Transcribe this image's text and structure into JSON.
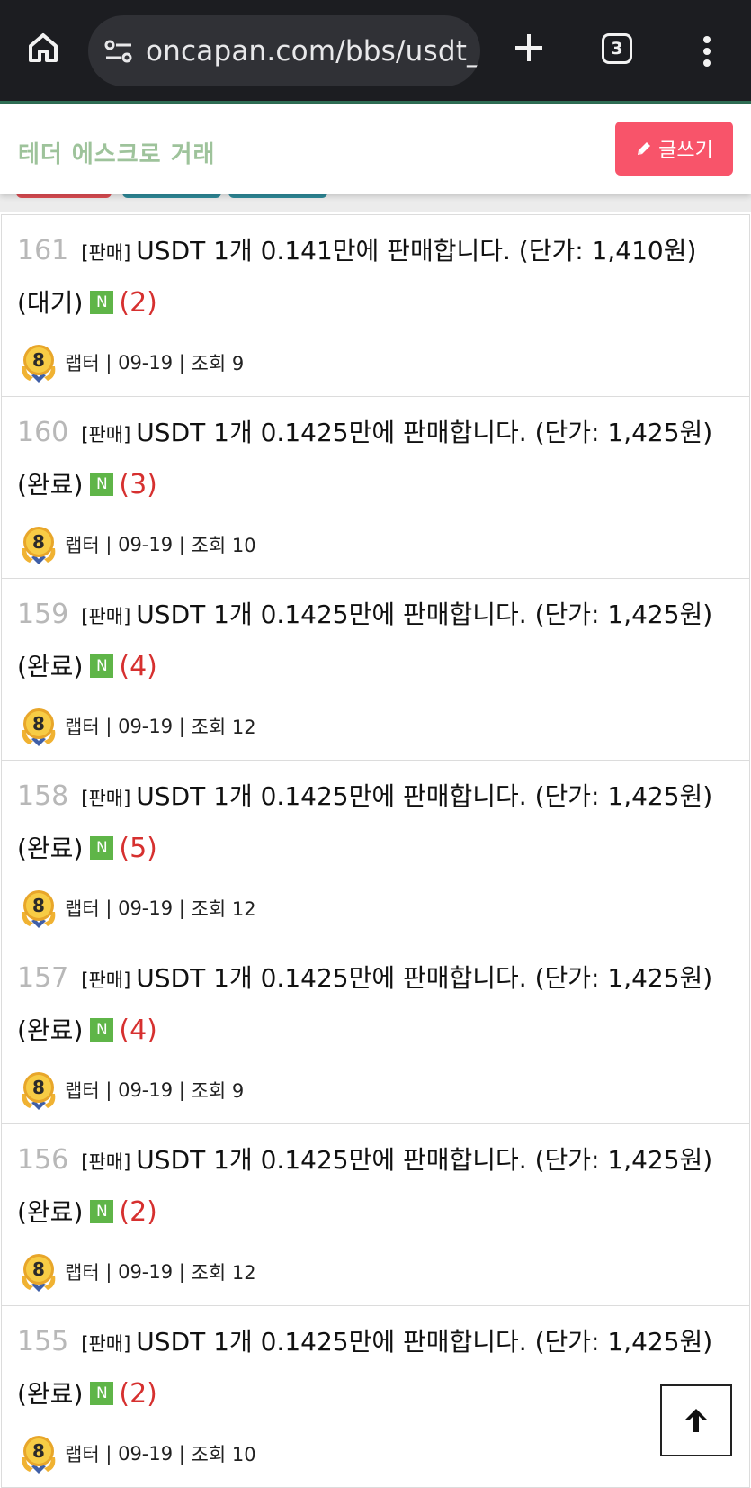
{
  "browser": {
    "url": "oncapan.com/bbs/usdt_",
    "tab_count": "3",
    "colors": {
      "toolbar": "#1c1d21",
      "url_bar": "#303136"
    }
  },
  "header": {
    "title": "테더 에스크로 거래",
    "write_label": "글쓰기",
    "colors": {
      "title": "#9ec39b",
      "write_button": "#f8546a"
    }
  },
  "category_tabs": [
    {
      "color": "#dd4d52"
    },
    {
      "color": "#2e8a99"
    },
    {
      "color": "#2e8a99"
    }
  ],
  "posts": [
    {
      "num": "161",
      "category": "[판매]",
      "title": "USDT 1개 0.141만에 판매합니다. (단가: 1,410원) (대기)",
      "badge": "N",
      "comments": "(2)",
      "author": "랩터",
      "date": "09-19",
      "views": "조회 9",
      "level": "8"
    },
    {
      "num": "160",
      "category": "[판매]",
      "title": "USDT 1개 0.1425만에 판매합니다. (단가: 1,425원) (완료)",
      "badge": "N",
      "comments": "(3)",
      "author": "랩터",
      "date": "09-19",
      "views": "조회 10",
      "level": "8"
    },
    {
      "num": "159",
      "category": "[판매]",
      "title": "USDT 1개 0.1425만에 판매합니다. (단가: 1,425원) (완료)",
      "badge": "N",
      "comments": "(4)",
      "author": "랩터",
      "date": "09-19",
      "views": "조회 12",
      "level": "8"
    },
    {
      "num": "158",
      "category": "[판매]",
      "title": "USDT 1개 0.1425만에 판매합니다. (단가: 1,425원) (완료)",
      "badge": "N",
      "comments": "(5)",
      "author": "랩터",
      "date": "09-19",
      "views": "조회 12",
      "level": "8"
    },
    {
      "num": "157",
      "category": "[판매]",
      "title": "USDT 1개 0.1425만에 판매합니다. (단가: 1,425원) (완료)",
      "badge": "N",
      "comments": "(4)",
      "author": "랩터",
      "date": "09-19",
      "views": "조회 9",
      "level": "8"
    },
    {
      "num": "156",
      "category": "[판매]",
      "title": "USDT 1개 0.1425만에 판매합니다. (단가: 1,425원) (완료)",
      "badge": "N",
      "comments": "(2)",
      "author": "랩터",
      "date": "09-19",
      "views": "조회 12",
      "level": "8"
    },
    {
      "num": "155",
      "category": "[판매]",
      "title": "USDT 1개 0.1425만에 판매합니다. (단가: 1,425원) (완료)",
      "badge": "N",
      "comments": "(2)",
      "author": "랩터",
      "date": "09-19",
      "views": "조회 10",
      "level": "8"
    }
  ],
  "icons": {
    "home": "home-icon",
    "site_settings": "tune-icon",
    "new_tab": "plus-icon",
    "tabs": "tab-switcher-icon",
    "menu": "more-vert-icon",
    "write": "pencil-icon",
    "scroll_top": "arrow-up-icon",
    "level_badge": "level-medal-icon"
  }
}
